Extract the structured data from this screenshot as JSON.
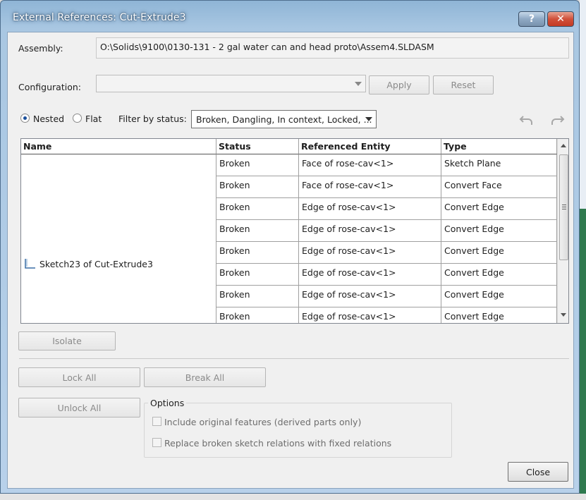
{
  "window": {
    "title": "External References: Cut-Extrude3",
    "help_label": "?",
    "close_label": "✕"
  },
  "assembly": {
    "label": "Assembly:",
    "value": "O:\\Solids\\9100\\0130-131 - 2 gal water can and head proto\\Assem4.SLDASM"
  },
  "configuration": {
    "label": "Configuration:",
    "value": "",
    "apply_label": "Apply",
    "reset_label": "Reset"
  },
  "view_mode": {
    "nested_label": "Nested",
    "flat_label": "Flat",
    "selected": "Nested"
  },
  "filter": {
    "label": "Filter by status:",
    "value": "Broken, Dangling, In context, Locked, ..."
  },
  "icons": {
    "undo": "undo-icon",
    "redo": "redo-icon",
    "sketch": "sketch-icon"
  },
  "table": {
    "columns": [
      "Name",
      "Status",
      "Referenced Entity",
      "Type"
    ],
    "group_name": "Sketch23  of  Cut-Extrude3",
    "rows": [
      {
        "status": "Broken",
        "entity": "Face of rose-cav<1>",
        "type": "Sketch Plane"
      },
      {
        "status": "Broken",
        "entity": "Face of rose-cav<1>",
        "type": "Convert Face"
      },
      {
        "status": "Broken",
        "entity": "Edge of rose-cav<1>",
        "type": "Convert Edge"
      },
      {
        "status": "Broken",
        "entity": "Edge of rose-cav<1>",
        "type": "Convert Edge"
      },
      {
        "status": "Broken",
        "entity": "Edge of rose-cav<1>",
        "type": "Convert Edge"
      },
      {
        "status": "Broken",
        "entity": "Edge of rose-cav<1>",
        "type": "Convert Edge"
      },
      {
        "status": "Broken",
        "entity": "Edge of rose-cav<1>",
        "type": "Convert Edge"
      },
      {
        "status": "Broken",
        "entity": "Edge of rose-cav<1>",
        "type": "Convert Edge"
      }
    ]
  },
  "buttons": {
    "isolate": "Isolate",
    "lock_all": "Lock All",
    "break_all": "Break All",
    "unlock_all": "Unlock All",
    "close": "Close"
  },
  "options": {
    "title": "Options",
    "include_original": "Include original features (derived parts only)",
    "replace_broken": "Replace broken sketch relations with fixed relations"
  }
}
